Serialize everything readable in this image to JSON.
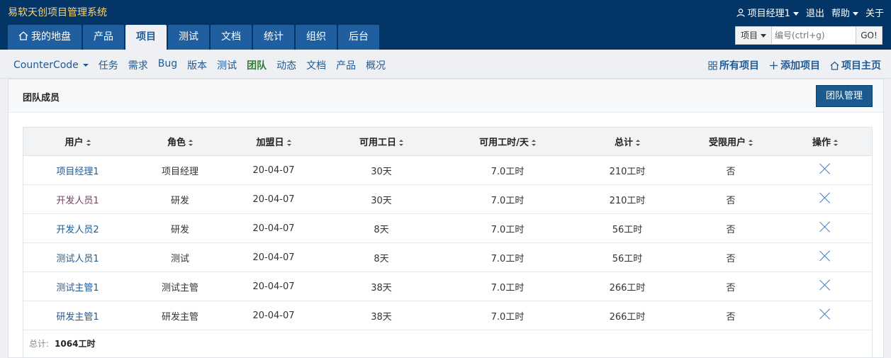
{
  "brand": "易软天创项目管理系统",
  "user_menu": {
    "user": "项目经理1",
    "logout": "退出",
    "help": "帮助",
    "about": "关于"
  },
  "nav": {
    "tabs": [
      "我的地盘",
      "产品",
      "项目",
      "测试",
      "文档",
      "统计",
      "组织",
      "后台"
    ],
    "active": 2
  },
  "search": {
    "type": "项目",
    "placeholder": "编号(ctrl+g)",
    "go": "GO!"
  },
  "subnav": {
    "project": "CounterCode",
    "items": [
      "任务",
      "需求",
      "Bug",
      "版本",
      "测试",
      "团队",
      "动态",
      "文档",
      "产品",
      "概况"
    ],
    "active": 5,
    "actions": [
      "所有项目",
      "添加项目",
      "项目主页"
    ]
  },
  "panel": {
    "title": "团队成员",
    "manage_button": "团队管理"
  },
  "table": {
    "headers": [
      "用户",
      "角色",
      "加盟日",
      "可用工日",
      "可用工时/天",
      "总计",
      "受限用户",
      "操作"
    ],
    "rows": [
      {
        "user": "项目经理1",
        "role": "项目经理",
        "join": "20-04-07",
        "days": "30天",
        "hours_per_day": "7.0工时",
        "total": "210工时",
        "limited": "否"
      },
      {
        "user": "开发人员1",
        "role": "研发",
        "join": "20-04-07",
        "days": "30天",
        "hours_per_day": "7.0工时",
        "total": "210工时",
        "limited": "否"
      },
      {
        "user": "开发人员2",
        "role": "研发",
        "join": "20-04-07",
        "days": "8天",
        "hours_per_day": "7.0工时",
        "total": "56工时",
        "limited": "否"
      },
      {
        "user": "测试人员1",
        "role": "测试",
        "join": "20-04-07",
        "days": "8天",
        "hours_per_day": "7.0工时",
        "total": "56工时",
        "limited": "否"
      },
      {
        "user": "测试主管1",
        "role": "测试主管",
        "join": "20-04-07",
        "days": "38天",
        "hours_per_day": "7.0工时",
        "total": "266工时",
        "limited": "否"
      },
      {
        "user": "研发主管1",
        "role": "研发主管",
        "join": "20-04-07",
        "days": "38天",
        "hours_per_day": "7.0工时",
        "total": "266工时",
        "limited": "否"
      }
    ]
  },
  "footer": {
    "label": "总计:",
    "value": "1064工时"
  }
}
